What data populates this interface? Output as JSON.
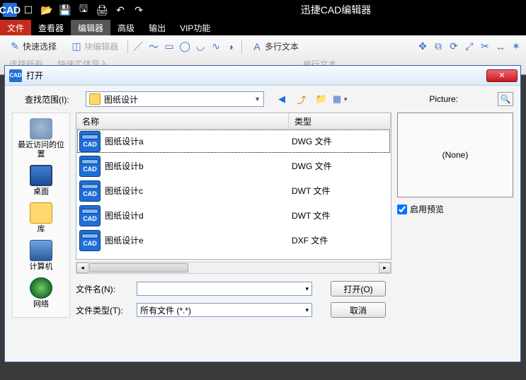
{
  "app": {
    "title": "迅捷CAD编辑器",
    "quickIcons": [
      "CAD",
      "＋",
      "📂",
      "💾",
      "💾",
      "🖨",
      "↶",
      "↷"
    ]
  },
  "menu": {
    "file": "文件",
    "viewer": "查看器",
    "editor": "编辑器",
    "advanced": "高级",
    "output": "输出",
    "vip": "VIP功能"
  },
  "toolbar": {
    "quickSelect": "快速选择",
    "blockEditor": "块编辑器",
    "multiText": "多行文本",
    "rowB_left": "选择所有",
    "rowB_next": "快速实体导入",
    "rowB_right": "单行文本"
  },
  "dialog": {
    "title": "打开",
    "lookIn_label": "查找范围(I):",
    "folder": "图纸设计",
    "picture_label": "Picture:",
    "preview_none": "(None)",
    "enablePreview": "启用预览",
    "col_name": "名称",
    "col_type": "类型",
    "files": [
      {
        "name": "图纸设计a",
        "type": "DWG 文件"
      },
      {
        "name": "图纸设计b",
        "type": "DWG 文件"
      },
      {
        "name": "图纸设计c",
        "type": "DWT 文件"
      },
      {
        "name": "图纸设计d",
        "type": "DWT 文件"
      },
      {
        "name": "图纸设计e",
        "type": "DXF 文件"
      }
    ],
    "fileName_label": "文件名(N):",
    "fileType_label": "文件类型(T):",
    "fileType_value": "所有文件 (*.*)",
    "openBtn": "打开(O)",
    "cancelBtn": "取消"
  },
  "places": {
    "recent": "最近访问的位置",
    "desktop": "桌面",
    "libraries": "库",
    "computer": "计算机",
    "network": "网络"
  }
}
